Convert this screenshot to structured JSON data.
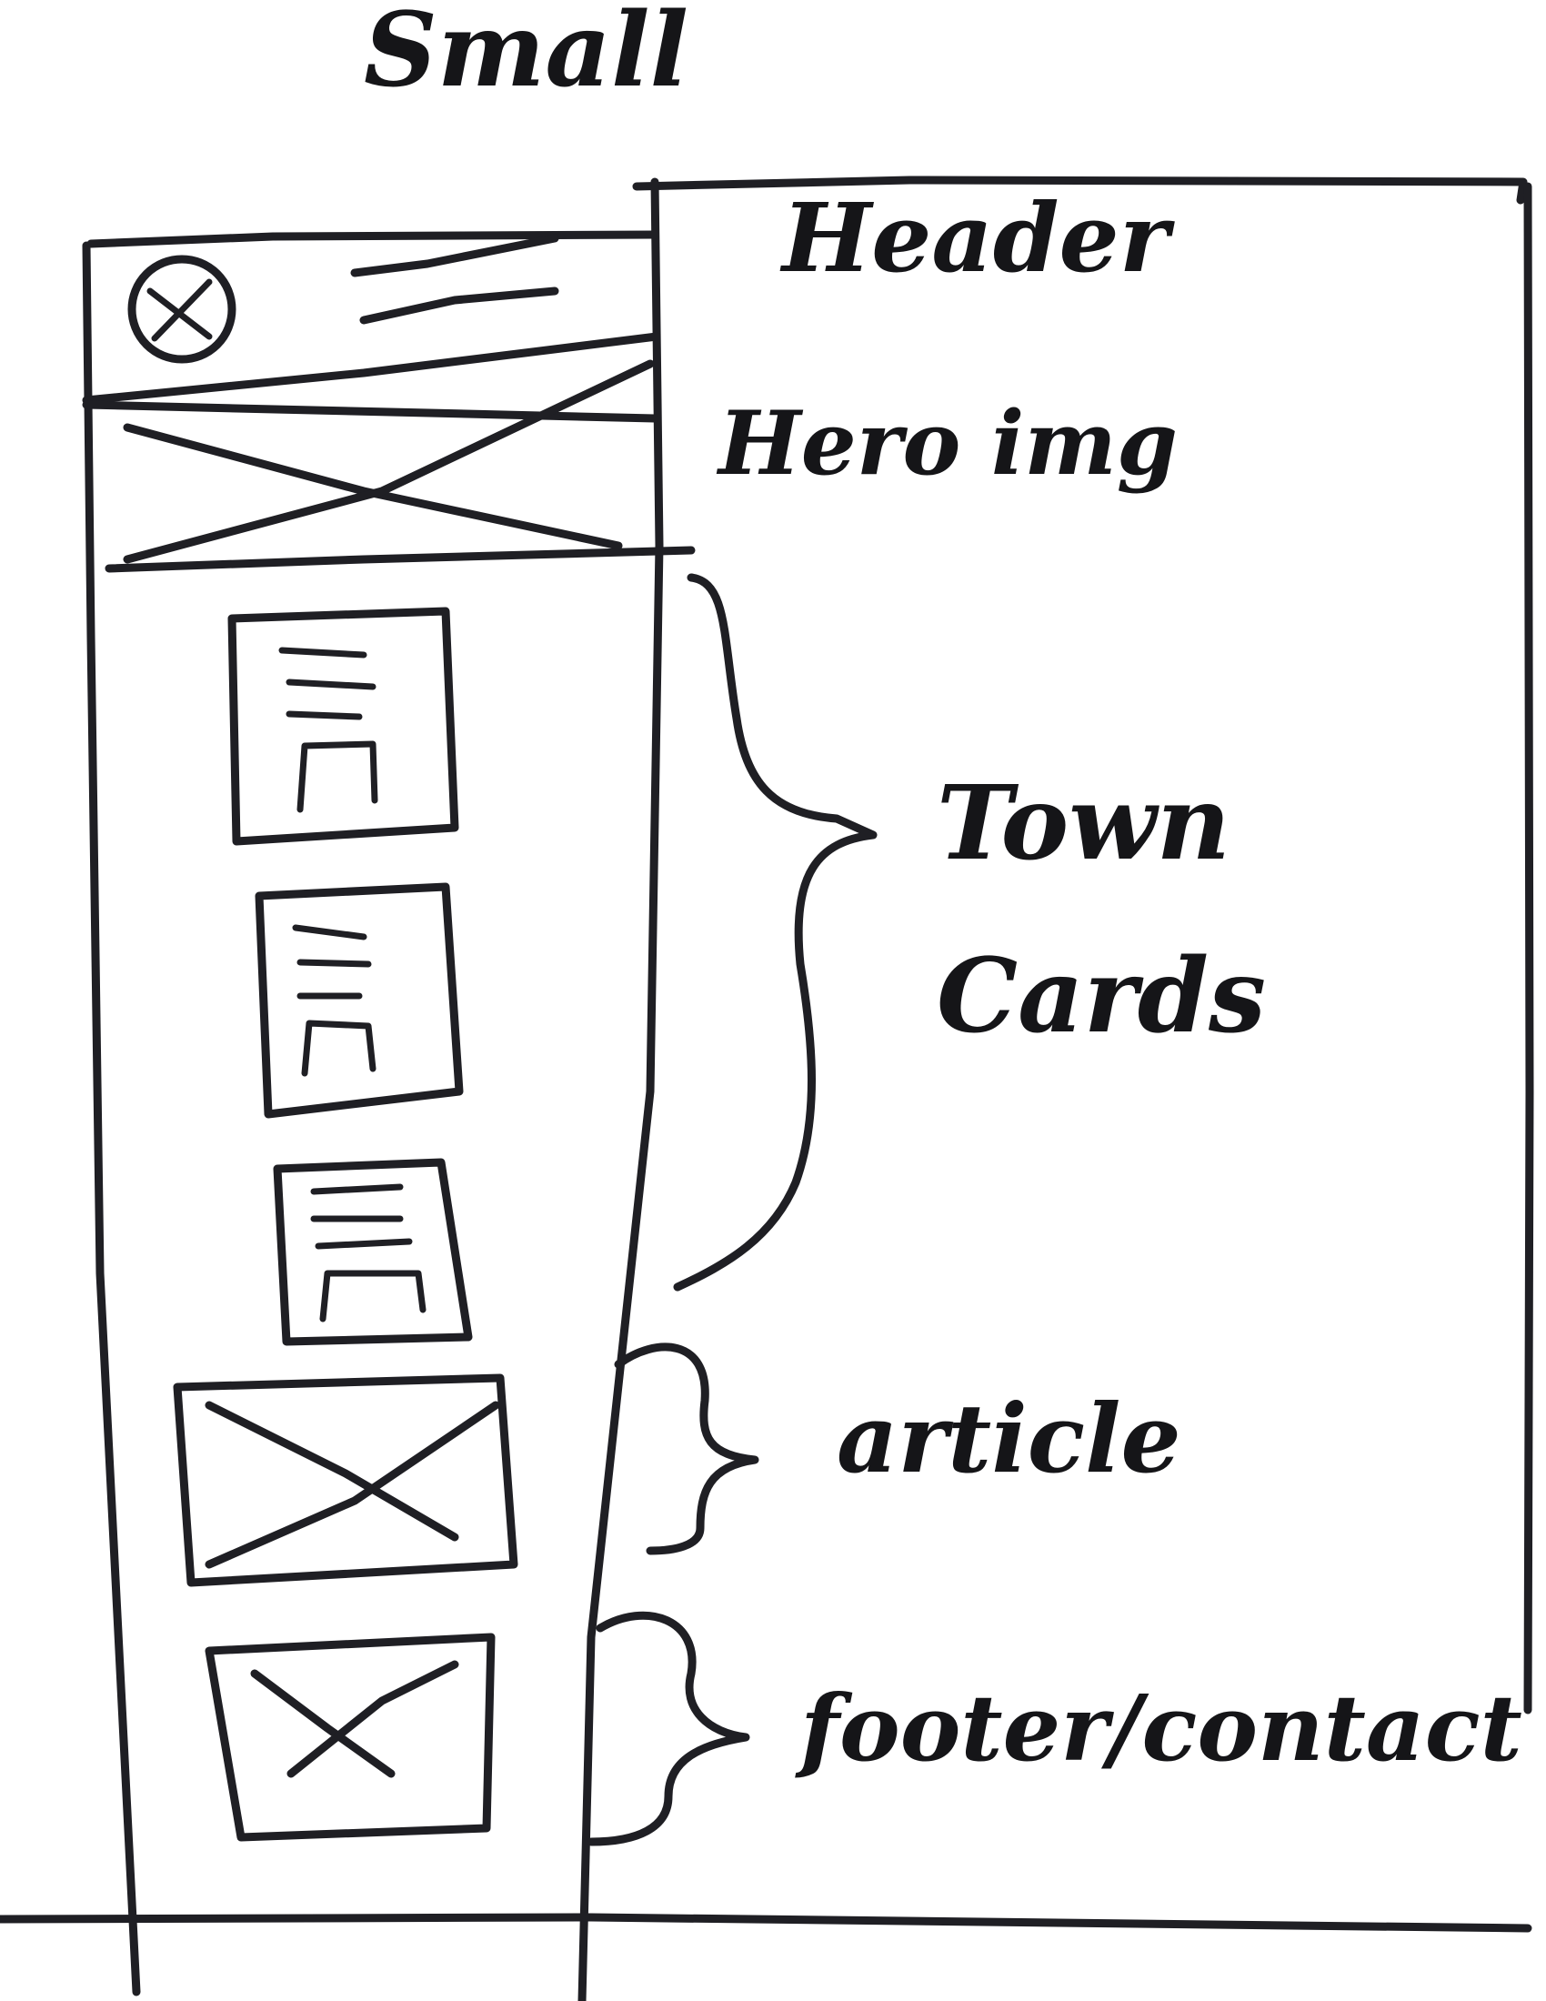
{
  "sketch": {
    "title": "Small",
    "labels": {
      "header": "Header",
      "hero": "Hero img",
      "town": "Town",
      "cards": "Cards",
      "article": "article",
      "footer": "footer/contact"
    },
    "town_card_count": 3
  },
  "colors": {
    "ink": "#1f1f24",
    "paper": "#ffffff"
  }
}
